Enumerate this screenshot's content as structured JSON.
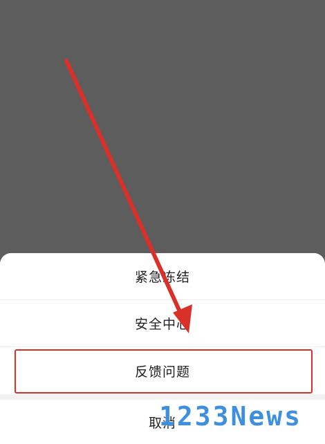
{
  "action_sheet": {
    "items": [
      {
        "label": "紧急冻结"
      },
      {
        "label": "安全中心"
      },
      {
        "label": "反馈问题"
      }
    ],
    "cancel_label": "取消"
  },
  "watermark": {
    "text": "1233News"
  },
  "colors": {
    "backdrop": "#5d5d5d",
    "sheet": "#ffffff",
    "annotation_red": "#d9302a",
    "watermark_blue": "#3f8fe0"
  }
}
